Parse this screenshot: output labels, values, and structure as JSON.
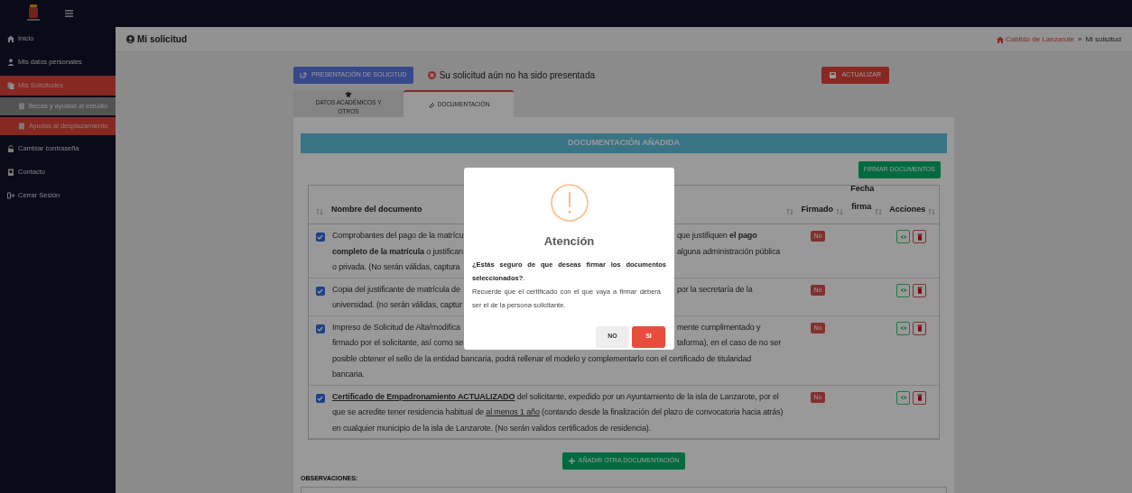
{
  "sidebar": {
    "items": [
      {
        "label": "Inicio",
        "kind": "item",
        "selected": false
      },
      {
        "label": "Mis datos personales",
        "kind": "item",
        "selected": false
      },
      {
        "label": "Mis Solicitudes",
        "kind": "item",
        "selected": true
      },
      {
        "label": "Becas y ayudas al estudio",
        "kind": "subitem",
        "selected": false
      },
      {
        "label": "Ayudas al desplazamiento",
        "kind": "subitem",
        "selected": true
      },
      {
        "label": "Cambiar contraseña",
        "kind": "item",
        "selected": false
      },
      {
        "label": "Contacto",
        "kind": "item",
        "selected": false
      },
      {
        "label": "Cerrar Sesión",
        "kind": "item",
        "selected": false
      }
    ]
  },
  "header": {
    "title": "Mi solicitud",
    "breadcrumb": [
      "Cabildo de Lanzarote",
      "Mi solicitud"
    ],
    "separator": "»"
  },
  "toolbar": {
    "submit_button": "PRESENTACIÓN DE SOLICITUD",
    "status": "Su solicitud aún no ha sido presentada",
    "update_button": "ACTUALIZAR"
  },
  "tabs": [
    {
      "label": "DATOS ACADÉMICOS Y OTROS",
      "selected": false
    },
    {
      "label": "DOCUMENTACIÓN",
      "selected": true
    }
  ],
  "section_title": "DOCUMENTACIÓN AÑADIDA",
  "sign_button": "FIRMAR DOCUMENTOS",
  "table": {
    "columns": [
      "Nombre del documento",
      "Firmado",
      "Fecha firma",
      "Acciones"
    ],
    "rows": [
      {
        "checked": true,
        "signed": "No",
        "kind": "covered",
        "lines": [
          {
            "left": "Comprobantes del pago de la matrícu",
            "right": "que justifiquen **el pago**"
          },
          {
            "left": "**completo de la matrícula** o justifican",
            "right": "alguna administración pública"
          },
          {
            "left": "o privada. (No serán válidas, captura"
          }
        ]
      },
      {
        "checked": true,
        "signed": "No",
        "kind": "covered",
        "lines": [
          {
            "left": "Copia del justificante de matrícula de",
            "right": "por la secretaría de la"
          },
          {
            "left": "universidad. (no serán válidas, captur"
          }
        ]
      },
      {
        "checked": true,
        "signed": "No",
        "kind": "covered",
        "lines": [
          {
            "left": "Impreso de Solicitud de Alta/modifica",
            "right": "mente cumplimentado y"
          },
          {
            "left": "firmado por el solicitante, así como se",
            "right": "taforma), en el caso de no ser"
          },
          {
            "left": "posible obtener el sello de la entidad bancaria, podrá rellenar el modelo y complementarlo con el certificado de titularidad"
          },
          {
            "left": "bancaria."
          }
        ]
      },
      {
        "checked": true,
        "signed": "No",
        "kind": "full",
        "parts": [
          {
            "text": "Certificado de Empadronamiento ACTUALIZADO",
            "bold": true,
            "underline": true
          },
          {
            "text": " del solicitante, expedido por un Ayuntamiento de la isla de Lanzarote, por el que se acredite tener residencia habitual de ",
            "bold": false,
            "underline": false
          },
          {
            "text": "al menos 1 año",
            "bold": false,
            "underline": true
          },
          {
            "text": " (contando desde la finalización del plazo de convocatoria hacia atrás) en cualquier municipio de la isla de Lanzarote. (No serán validos certificados de residencia).",
            "bold": false,
            "underline": false
          }
        ]
      }
    ]
  },
  "add_button": "AÑADIR OTRA DOCUMENTACIÓN",
  "observations_label": "OBSERVACIONES:",
  "modal": {
    "title": "Atención",
    "question": "**¿Estás seguro de que deseas firmar los documentos seleccionados?**.",
    "note": "Recuerde que el certificado con el que vaya a firmar deberá ser el de la persona solicitante.",
    "buttons": [
      "NO",
      "SI"
    ]
  }
}
